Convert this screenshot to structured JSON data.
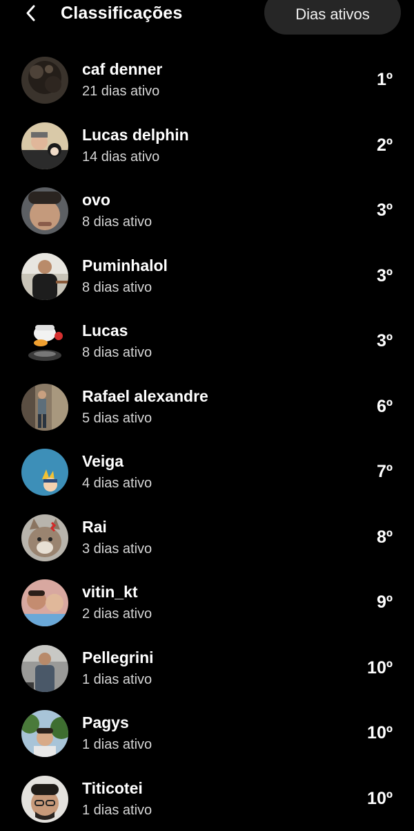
{
  "header": {
    "title": "Classificações",
    "filter_label": "Dias ativos"
  },
  "rows": [
    {
      "name": "caf denner",
      "sub": "21 dias ativo",
      "rank": "1º",
      "avatar": "avatar-dark-hair"
    },
    {
      "name": "Lucas delphin",
      "sub": "14 dias ativo",
      "rank": "2º",
      "avatar": "avatar-two-people-photo"
    },
    {
      "name": "ovo",
      "sub": "8 dias ativo",
      "rank": "3º",
      "avatar": "avatar-selfie-face"
    },
    {
      "name": "Puminhalol",
      "sub": "8 dias ativo",
      "rank": "3º",
      "avatar": "avatar-person-outdoor"
    },
    {
      "name": "Lucas",
      "sub": "8 dias ativo",
      "rank": "3º",
      "avatar": "avatar-cartoon-duck-headphones"
    },
    {
      "name": "Rafael alexandre",
      "sub": "5 dias ativo",
      "rank": "6º",
      "avatar": "avatar-full-body-photo"
    },
    {
      "name": "Veiga",
      "sub": "4 dias ativo",
      "rank": "7º",
      "avatar": "avatar-anime-character-blue"
    },
    {
      "name": "Rai",
      "sub": "3 dias ativo",
      "rank": "8º",
      "avatar": "avatar-angry-cat"
    },
    {
      "name": "vitin_kt",
      "sub": "2 dias ativo",
      "rank": "9º",
      "avatar": "avatar-group-selfie"
    },
    {
      "name": "Pellegrini",
      "sub": "1 dias ativo",
      "rank": "10º",
      "avatar": "avatar-person-standing"
    },
    {
      "name": "Pagys",
      "sub": "1 dias ativo",
      "rank": "10º",
      "avatar": "avatar-person-trees"
    },
    {
      "name": "Titicotei",
      "sub": "1 dias ativo",
      "rank": "10º",
      "avatar": "avatar-man-glasses"
    }
  ],
  "icons": {
    "back": "chevron-left-icon"
  },
  "colors": {
    "background": "#000000",
    "pill_background": "#262626",
    "text_primary": "#ffffff",
    "text_secondary": "#d6d6d6"
  }
}
